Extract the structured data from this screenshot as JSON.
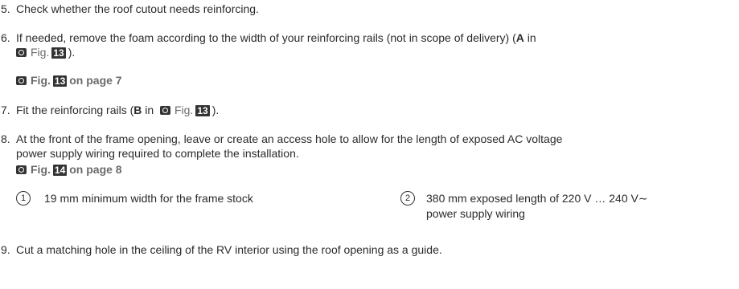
{
  "steps": {
    "s5": {
      "num": "5.",
      "text": "Check whether the roof cutout needs reinforcing."
    },
    "s6": {
      "num": "6.",
      "text_a": "If needed, remove the foam according to the width of your reinforcing rails (not in scope of delivery) (",
      "letter": "A",
      "text_b": " in",
      "fig_word": "Fig.",
      "fig_num": "13",
      "text_c": ")."
    },
    "s6_figref": {
      "word": "Fig.",
      "num": "13",
      "page": "on page 7"
    },
    "s7": {
      "num": "7.",
      "text_a": "Fit the reinforcing rails (",
      "letter": "B",
      "text_b": " in",
      "fig_word": "Fig.",
      "fig_num": "13",
      "text_c": ")."
    },
    "s8": {
      "num": "8.",
      "line1": "At the front of the frame opening, leave or create an access hole to allow for the length of exposed AC voltage",
      "line2": "power supply wiring required to complete the installation."
    },
    "s8_figref": {
      "word": "Fig.",
      "num": "14",
      "page": "on page 8"
    },
    "s9": {
      "num": "9.",
      "text": "Cut a matching hole in the ceiling of the RV interior using the roof opening as a guide."
    }
  },
  "legend": [
    {
      "marker": "1",
      "text": "19 mm minimum width for the frame stock"
    },
    {
      "marker": "2",
      "text_line1": "380 mm exposed length of  220 V  …  240 V∼",
      "text_line2": "power supply wiring"
    }
  ],
  "icons": {
    "figure": "camera-icon"
  },
  "colors": {
    "text": "#2b2b2b",
    "figref": "#6b6b6b",
    "badge_bg": "#333333"
  }
}
